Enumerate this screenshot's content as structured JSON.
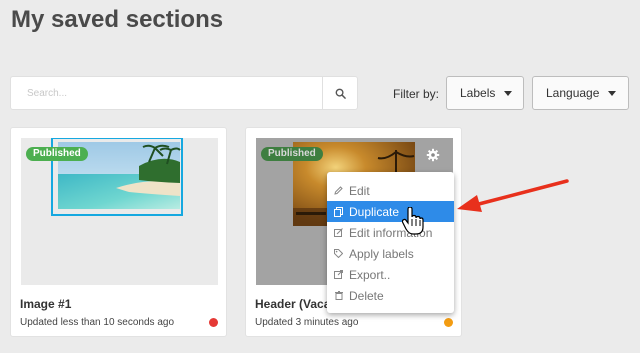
{
  "page": {
    "title": "My saved sections"
  },
  "search": {
    "placeholder": "Search..."
  },
  "filter": {
    "label": "Filter by:",
    "labels_button": "Labels",
    "language_button": "Language"
  },
  "cards": [
    {
      "badge": "Published",
      "name": "Image #1",
      "updated": "Updated less than 10 seconds ago",
      "status_color": "#e53935"
    },
    {
      "badge": "Published",
      "name": "Header (Vacation)",
      "updated": "Updated 3 minutes ago",
      "status_color": "#f39c12"
    }
  ],
  "context_menu": {
    "items": [
      {
        "label": "Edit",
        "icon": "pencil-icon"
      },
      {
        "label": "Duplicate",
        "icon": "copy-icon"
      },
      {
        "label": "Edit information",
        "icon": "edit-info-icon"
      },
      {
        "label": "Apply labels",
        "icon": "tag-icon"
      },
      {
        "label": "Export..",
        "icon": "export-icon"
      },
      {
        "label": "Delete",
        "icon": "trash-icon"
      }
    ]
  },
  "colors": {
    "accent": "#2e8be8",
    "published": "#4caf50",
    "arrow": "#e8301c"
  }
}
